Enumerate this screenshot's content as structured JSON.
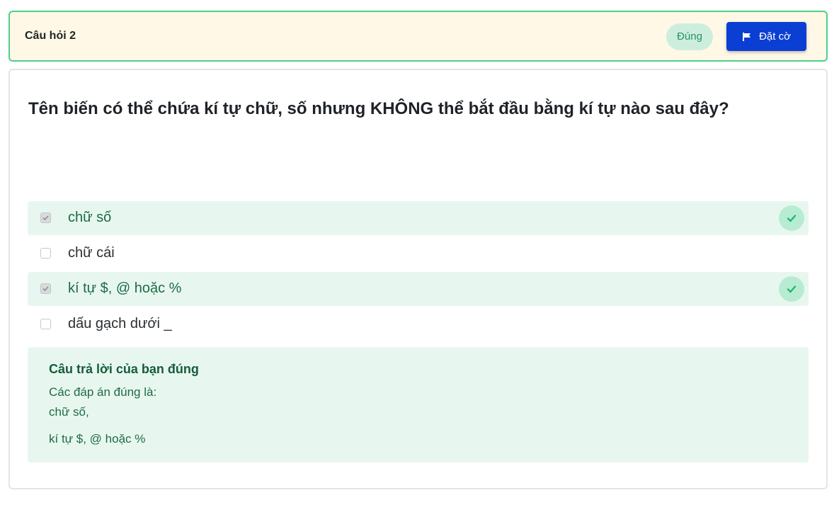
{
  "header": {
    "question_label": "Câu hỏi 2",
    "status": "Đúng",
    "flag_label": "Đặt cờ"
  },
  "question": {
    "text": "Tên biến có thể chứa kí tự chữ, số nhưng KHÔNG thể bắt đầu bằng kí tự nào sau đây?"
  },
  "options": [
    {
      "label": "chữ số",
      "checked": true,
      "correct": true
    },
    {
      "label": "chữ cái",
      "checked": false,
      "correct": false
    },
    {
      "label": "kí tự $, @ hoặc %",
      "checked": true,
      "correct": true
    },
    {
      "label": "dấu gạch dưới _",
      "checked": false,
      "correct": false
    }
  ],
  "feedback": {
    "title": "Câu trả lời của bạn đúng",
    "intro": "Các đáp án đúng là:",
    "answers": [
      "chữ số,",
      "kí tự $, @ hoặc %"
    ]
  },
  "colors": {
    "header_bg": "#fff8e6",
    "header_border": "#4ccf8a",
    "primary_button": "#0b3fd3",
    "correct_bg": "#e7f7ef",
    "correct_text": "#1f6a47"
  }
}
